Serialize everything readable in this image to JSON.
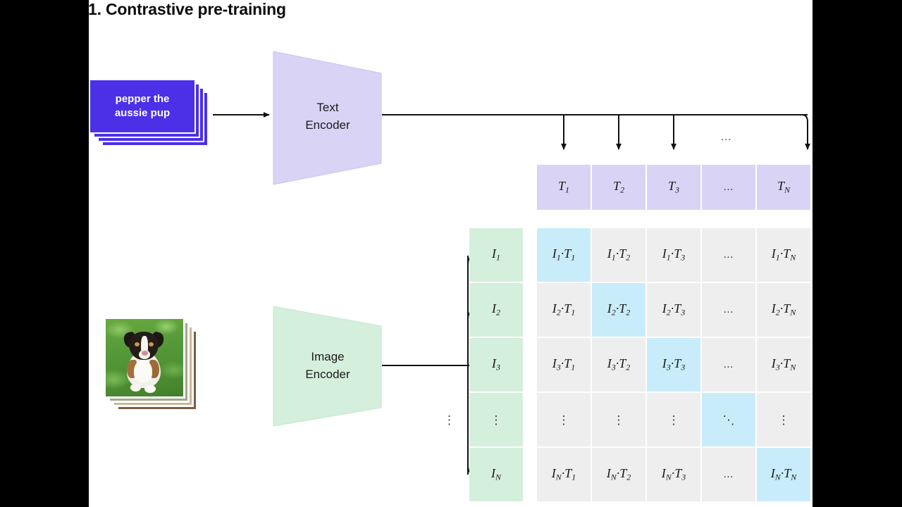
{
  "title": "1. Contrastive pre-training",
  "text_input": {
    "label": "pepper the aussie pup",
    "line1": "pepper the",
    "line2": "aussie pup",
    "color": "#4b30e8",
    "stack_count": 4
  },
  "image_input": {
    "alt": "photo of an australian shepherd puppy sitting on grass",
    "stack_count": 4
  },
  "encoders": {
    "text": {
      "line1": "Text",
      "line2": "Encoder",
      "color": "#d9d4f5"
    },
    "image": {
      "line1": "Image",
      "line2": "Encoder",
      "color": "#d5efdd"
    }
  },
  "colors": {
    "text_embedding": "#d9d4f5",
    "image_embedding": "#d5efdd",
    "matrix_cell": "#eeeeee",
    "matrix_diagonal": "#c9ecfb",
    "arrow": "#111111",
    "canvas": "#ffffff",
    "letterbox": "#000000"
  },
  "text_embeddings": [
    {
      "base": "T",
      "sub": "1",
      "ellipsis": false
    },
    {
      "base": "T",
      "sub": "2",
      "ellipsis": false
    },
    {
      "base": "T",
      "sub": "3",
      "ellipsis": false
    },
    {
      "base": "",
      "sub": "",
      "ellipsis": true,
      "text": "..."
    },
    {
      "base": "T",
      "sub": "N",
      "ellipsis": false
    }
  ],
  "image_embeddings": [
    {
      "base": "I",
      "sub": "1",
      "ellipsis": false
    },
    {
      "base": "I",
      "sub": "2",
      "ellipsis": false
    },
    {
      "base": "I",
      "sub": "3",
      "ellipsis": false
    },
    {
      "base": "",
      "sub": "",
      "ellipsis": true,
      "text": "⋮"
    },
    {
      "base": "I",
      "sub": "N",
      "ellipsis": false
    }
  ],
  "matrix": {
    "row_labels": [
      "1",
      "2",
      "3",
      "",
      "N"
    ],
    "col_labels": [
      "1",
      "2",
      "3",
      "",
      "N"
    ],
    "rows": [
      [
        {
          "text": "I₁·T₁",
          "i": "1",
          "t": "1",
          "kind": "dot",
          "diagonal": true
        },
        {
          "text": "I₁·T₂",
          "i": "1",
          "t": "2",
          "kind": "dot",
          "diagonal": false
        },
        {
          "text": "I₁·T₃",
          "i": "1",
          "t": "3",
          "kind": "dot",
          "diagonal": false
        },
        {
          "text": "...",
          "kind": "hdots",
          "diagonal": false
        },
        {
          "text": "I₁·Tₙ",
          "i": "1",
          "t": "N",
          "kind": "dot",
          "diagonal": false
        }
      ],
      [
        {
          "text": "I₂·T₁",
          "i": "2",
          "t": "1",
          "kind": "dot",
          "diagonal": false
        },
        {
          "text": "I₂·T₂",
          "i": "2",
          "t": "2",
          "kind": "dot",
          "diagonal": true
        },
        {
          "text": "I₂·T₃",
          "i": "2",
          "t": "3",
          "kind": "dot",
          "diagonal": false
        },
        {
          "text": "...",
          "kind": "hdots",
          "diagonal": false
        },
        {
          "text": "I₂·Tₙ",
          "i": "2",
          "t": "N",
          "kind": "dot",
          "diagonal": false
        }
      ],
      [
        {
          "text": "I₃·T₁",
          "i": "3",
          "t": "1",
          "kind": "dot",
          "diagonal": false
        },
        {
          "text": "I₃·T₂",
          "i": "3",
          "t": "2",
          "kind": "dot",
          "diagonal": false
        },
        {
          "text": "I₃·T₃",
          "i": "3",
          "t": "3",
          "kind": "dot",
          "diagonal": true
        },
        {
          "text": "...",
          "kind": "hdots",
          "diagonal": false
        },
        {
          "text": "I₃·Tₙ",
          "i": "3",
          "t": "N",
          "kind": "dot",
          "diagonal": false
        }
      ],
      [
        {
          "text": "⋮",
          "kind": "vdots",
          "diagonal": false
        },
        {
          "text": "⋮",
          "kind": "vdots",
          "diagonal": false
        },
        {
          "text": "⋮",
          "kind": "vdots",
          "diagonal": false
        },
        {
          "text": "⋱",
          "kind": "ddots",
          "diagonal": true
        },
        {
          "text": "⋮",
          "kind": "vdots",
          "diagonal": false
        }
      ],
      [
        {
          "text": "Iₙ·T₁",
          "i": "N",
          "t": "1",
          "kind": "dot",
          "diagonal": false
        },
        {
          "text": "Iₙ·T₂",
          "i": "N",
          "t": "2",
          "kind": "dot",
          "diagonal": false
        },
        {
          "text": "Iₙ·T₃",
          "i": "N",
          "t": "3",
          "kind": "dot",
          "diagonal": false
        },
        {
          "text": "...",
          "kind": "hdots",
          "diagonal": false
        },
        {
          "text": "Iₙ·Tₙ",
          "i": "N",
          "t": "N",
          "kind": "dot",
          "diagonal": true
        }
      ]
    ]
  },
  "annotations": {
    "text_row_ellipsis": "...",
    "image_col_ellipsis": "⋮"
  }
}
